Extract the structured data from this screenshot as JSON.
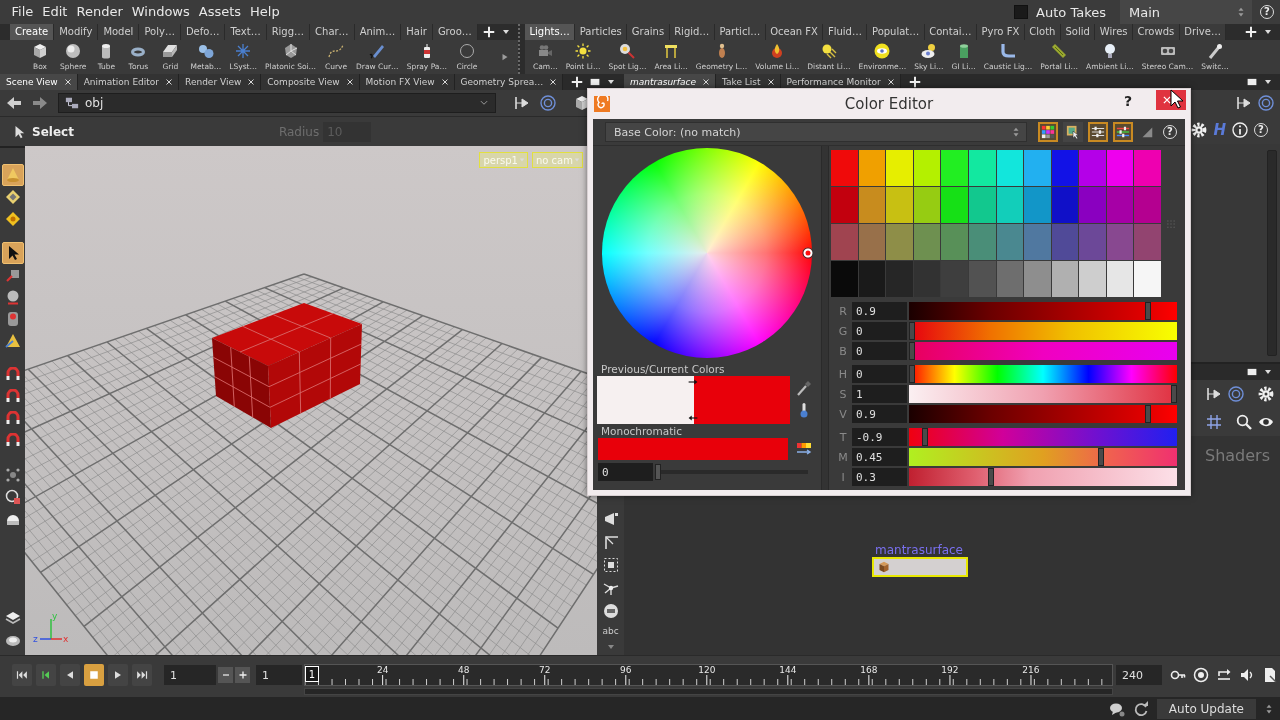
{
  "menu": [
    {
      "label": "File"
    },
    {
      "label": "Edit"
    },
    {
      "label": "Render"
    },
    {
      "label": "Windows"
    },
    {
      "label": "Assets"
    },
    {
      "label": "Help"
    }
  ],
  "auto_takes": {
    "label": "Auto Takes",
    "checked": false
  },
  "take": {
    "value": "Main"
  },
  "help_label": "?",
  "shelves": [
    {
      "tabs": [
        {
          "label": "Create",
          "selected": true
        },
        {
          "label": "Modify",
          "selected": false
        },
        {
          "label": "Model",
          "selected": false
        },
        {
          "label": "Poly…",
          "selected": false
        },
        {
          "label": "Defo…",
          "selected": false
        },
        {
          "label": "Text…",
          "selected": false
        },
        {
          "label": "Rigg…",
          "selected": false
        },
        {
          "label": "Char…",
          "selected": false
        },
        {
          "label": "Anim…",
          "selected": false
        },
        {
          "label": "Hair",
          "selected": false
        },
        {
          "label": "Groo…",
          "selected": false
        }
      ],
      "tools": [
        {
          "label": "Box"
        },
        {
          "label": "Sphere"
        },
        {
          "label": "Tube"
        },
        {
          "label": "Torus"
        },
        {
          "label": "Grid"
        },
        {
          "label": "Metab…"
        },
        {
          "label": "LSyst…"
        },
        {
          "label": "Platonic Soi…"
        },
        {
          "label": "Curve"
        },
        {
          "label": "Draw Cur…"
        },
        {
          "label": "Spray Pa…"
        },
        {
          "label": "Circle"
        }
      ]
    },
    {
      "tabs": [
        {
          "label": "Lights…",
          "selected": true
        },
        {
          "label": "Particles",
          "selected": false
        },
        {
          "label": "Grains",
          "selected": false
        },
        {
          "label": "Rigid…",
          "selected": false
        },
        {
          "label": "Particl…",
          "selected": false
        },
        {
          "label": "Ocean FX",
          "selected": false
        },
        {
          "label": "Fluid…",
          "selected": false
        },
        {
          "label": "Populat…",
          "selected": false
        },
        {
          "label": "Contai…",
          "selected": false
        },
        {
          "label": "Pyro FX",
          "selected": false
        },
        {
          "label": "Cloth",
          "selected": false
        },
        {
          "label": "Solid",
          "selected": false
        },
        {
          "label": "Wires",
          "selected": false
        },
        {
          "label": "Crowds",
          "selected": false
        },
        {
          "label": "Drive…",
          "selected": false
        }
      ],
      "tools": [
        {
          "label": "Cam…"
        },
        {
          "label": "Point Li…"
        },
        {
          "label": "Spot Lig…"
        },
        {
          "label": "Area Li…"
        },
        {
          "label": "Geometry L…"
        },
        {
          "label": "Volume Li…"
        },
        {
          "label": "Distant Li…"
        },
        {
          "label": "Environme…"
        },
        {
          "label": "Sky Li…"
        },
        {
          "label": "GI Li…"
        },
        {
          "label": "Caustic Lig…"
        },
        {
          "label": "Portal Li…"
        },
        {
          "label": "Ambient Li…"
        },
        {
          "label": "Stereo Cam…"
        },
        {
          "label": "Switc…"
        }
      ]
    }
  ],
  "scene_pane": {
    "tabs": [
      {
        "label": "Scene View",
        "selected": true
      },
      {
        "label": "Animation Editor",
        "selected": false
      },
      {
        "label": "Render View",
        "selected": false
      },
      {
        "label": "Composite View",
        "selected": false
      },
      {
        "label": "Motion FX View",
        "selected": false
      },
      {
        "label": "Geometry Sprea…",
        "selected": false
      }
    ],
    "path": "obj",
    "tool": "Select",
    "radius_label": "Radius",
    "radius": "10",
    "tool_groups": [
      {
        "tools": [
          {
            "selected": true
          },
          {
            "selected": false
          },
          {
            "selected": false
          }
        ]
      },
      {
        "tools": [
          {
            "selected": true
          },
          {
            "selected": false
          },
          {
            "selected": false
          },
          {
            "selected": false
          },
          {
            "selected": false
          }
        ]
      },
      {
        "tools": [
          {
            "selected": false
          },
          {
            "selected": false
          },
          {
            "selected": false
          },
          {
            "selected": false
          }
        ]
      },
      {
        "tools": [
          {
            "selected": false
          },
          {
            "selected": false
          },
          {
            "selected": false
          }
        ]
      },
      {
        "tools": [
          {
            "selected": false
          },
          {
            "selected": false
          }
        ]
      }
    ],
    "camera_menus": [
      {
        "label": "persp1"
      },
      {
        "label": "no cam"
      }
    ],
    "axes": [
      "y",
      "z",
      "x"
    ],
    "display_text_button": "abc"
  },
  "right_pane": {
    "tabs": [
      {
        "label": "mantrasurface",
        "kind": "network",
        "selected": true
      },
      {
        "label": "Take List",
        "kind": "pane",
        "selected": false
      },
      {
        "label": "Performance Monitor",
        "kind": "pane",
        "selected": false
      }
    ],
    "param_logo": "H",
    "param_help": "?",
    "network_context": "Shaders",
    "node": {
      "name": "mantrasurface",
      "selected": true
    }
  },
  "color_editor": {
    "title": "Color Editor",
    "help": "?",
    "parameter": "Base Color: (no match)",
    "modes": [
      {
        "selected": true
      },
      {
        "selected": false
      },
      {
        "selected": true
      },
      {
        "selected": true
      }
    ],
    "toolbar_help": "?",
    "swatches": [
      {
        "color": "#f00a0a"
      },
      {
        "color": "#f0a000"
      },
      {
        "color": "#e6ee00"
      },
      {
        "color": "#b4f000"
      },
      {
        "color": "#22ee22"
      },
      {
        "color": "#12e8a0"
      },
      {
        "color": "#12e6dc"
      },
      {
        "color": "#22b0f0"
      },
      {
        "color": "#1212e6"
      },
      {
        "color": "#b400e8"
      },
      {
        "color": "#ee00ee"
      },
      {
        "color": "#ee00b0"
      },
      {
        "color": "#c2000e"
      },
      {
        "color": "#c88c1e"
      },
      {
        "color": "#c8c012"
      },
      {
        "color": "#96cc12"
      },
      {
        "color": "#16e016"
      },
      {
        "color": "#12c88e"
      },
      {
        "color": "#12ceba"
      },
      {
        "color": "#1296c8"
      },
      {
        "color": "#1010c8"
      },
      {
        "color": "#8a00c0"
      },
      {
        "color": "#a600a6"
      },
      {
        "color": "#b40090"
      },
      {
        "color": "#a04450"
      },
      {
        "color": "#98704a"
      },
      {
        "color": "#8e8e48"
      },
      {
        "color": "#6e9050"
      },
      {
        "color": "#589058"
      },
      {
        "color": "#4a8e78"
      },
      {
        "color": "#4a8890"
      },
      {
        "color": "#5078a0"
      },
      {
        "color": "#504a98"
      },
      {
        "color": "#6c4898"
      },
      {
        "color": "#884890"
      },
      {
        "color": "#924470"
      },
      {
        "color": "#0a0a0a"
      },
      {
        "color": "#1a1a1a"
      },
      {
        "color": "#262626"
      },
      {
        "color": "#323232"
      },
      {
        "color": "#3e3e3e"
      },
      {
        "color": "#525252"
      },
      {
        "color": "#6e6e6e"
      },
      {
        "color": "#8e8e8e"
      },
      {
        "color": "#b0b0b0"
      },
      {
        "color": "#cecece"
      },
      {
        "color": "#e6e6e6"
      },
      {
        "color": "#f6f6f6"
      }
    ],
    "previous_label": "Previous/Current Colors",
    "previous": {
      "color": "#f6f0f0"
    },
    "current": {
      "color": "#e8000a"
    },
    "mono": {
      "label": "Monochromatic",
      "value": "0",
      "level": 0
    },
    "slider_groups": [
      {
        "sliders": [
          {
            "label": "R",
            "value": "0.9",
            "level": 0.9
          },
          {
            "label": "G",
            "value": "0",
            "level": 0
          },
          {
            "label": "B",
            "value": "0",
            "level": 0
          }
        ]
      },
      {
        "sliders": [
          {
            "label": "H",
            "value": "0",
            "level": 0
          },
          {
            "label": "S",
            "value": "1",
            "level": 1
          },
          {
            "label": "V",
            "value": "0.9",
            "level": 0.9
          }
        ]
      },
      {
        "sliders": [
          {
            "label": "T",
            "value": "-0.9",
            "level": 0.05
          },
          {
            "label": "M",
            "value": "0.45",
            "level": 0.72
          },
          {
            "label": "I",
            "value": "0.3",
            "level": 0.3
          }
        ]
      }
    ]
  },
  "timeline": {
    "transport": [
      {
        "selected": false
      },
      {
        "selected": false
      },
      {
        "selected": false
      },
      {
        "selected": true
      },
      {
        "selected": false
      },
      {
        "selected": false
      }
    ],
    "frame": "1",
    "start_frame": "1",
    "marker": "1",
    "ticks": [
      "24",
      "48",
      "72",
      "96",
      "120",
      "144",
      "168",
      "192",
      "216"
    ],
    "end": "240"
  },
  "status_bar": {
    "auto_update": "Auto Update"
  }
}
